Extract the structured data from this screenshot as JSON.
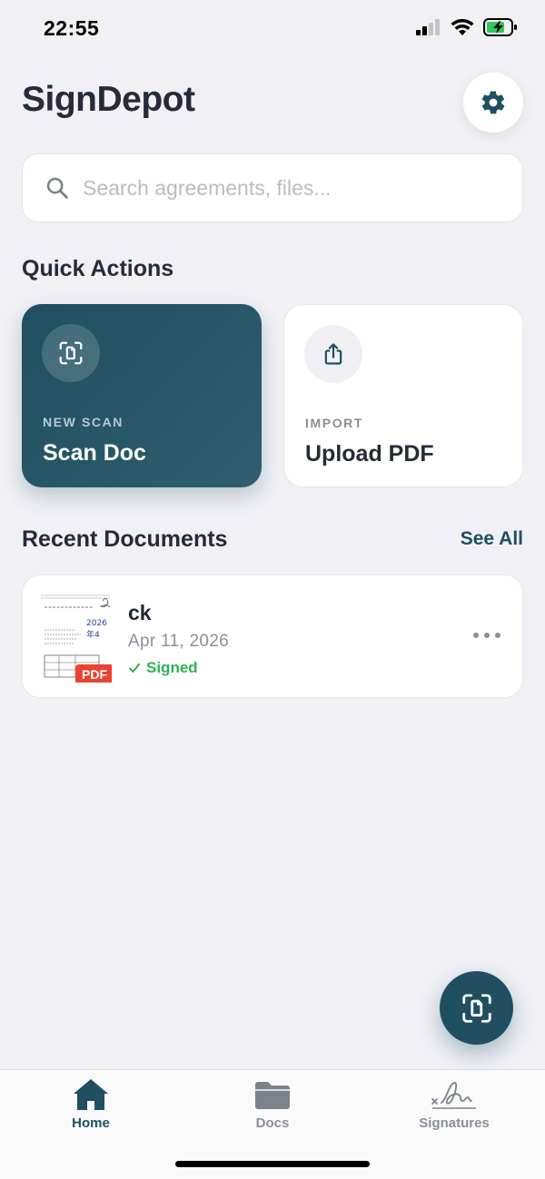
{
  "status_bar": {
    "time": "22:55"
  },
  "header": {
    "title": "SignDepot"
  },
  "search": {
    "placeholder": "Search agreements, files..."
  },
  "quick_actions": {
    "title": "Quick Actions",
    "cards": [
      {
        "kicker": "NEW SCAN",
        "title": "Scan Doc",
        "icon": "scan-document-icon"
      },
      {
        "kicker": "IMPORT",
        "title": "Upload PDF",
        "icon": "share-upload-icon"
      }
    ]
  },
  "recent": {
    "title": "Recent Documents",
    "see_all": "See All",
    "documents": [
      {
        "name": "ck",
        "date": "Apr 11, 2026",
        "status": "Signed",
        "badge": "PDF",
        "thumb_text": "2026年4"
      }
    ]
  },
  "tabs": [
    {
      "label": "Home",
      "icon": "home-icon",
      "active": true
    },
    {
      "label": "Docs",
      "icon": "folder-icon",
      "active": false
    },
    {
      "label": "Signatures",
      "icon": "signature-icon",
      "active": false
    }
  ],
  "colors": {
    "accent": "#1f4f60",
    "success": "#2db350",
    "pdf_badge": "#e94332",
    "background": "#f0f0f5"
  }
}
